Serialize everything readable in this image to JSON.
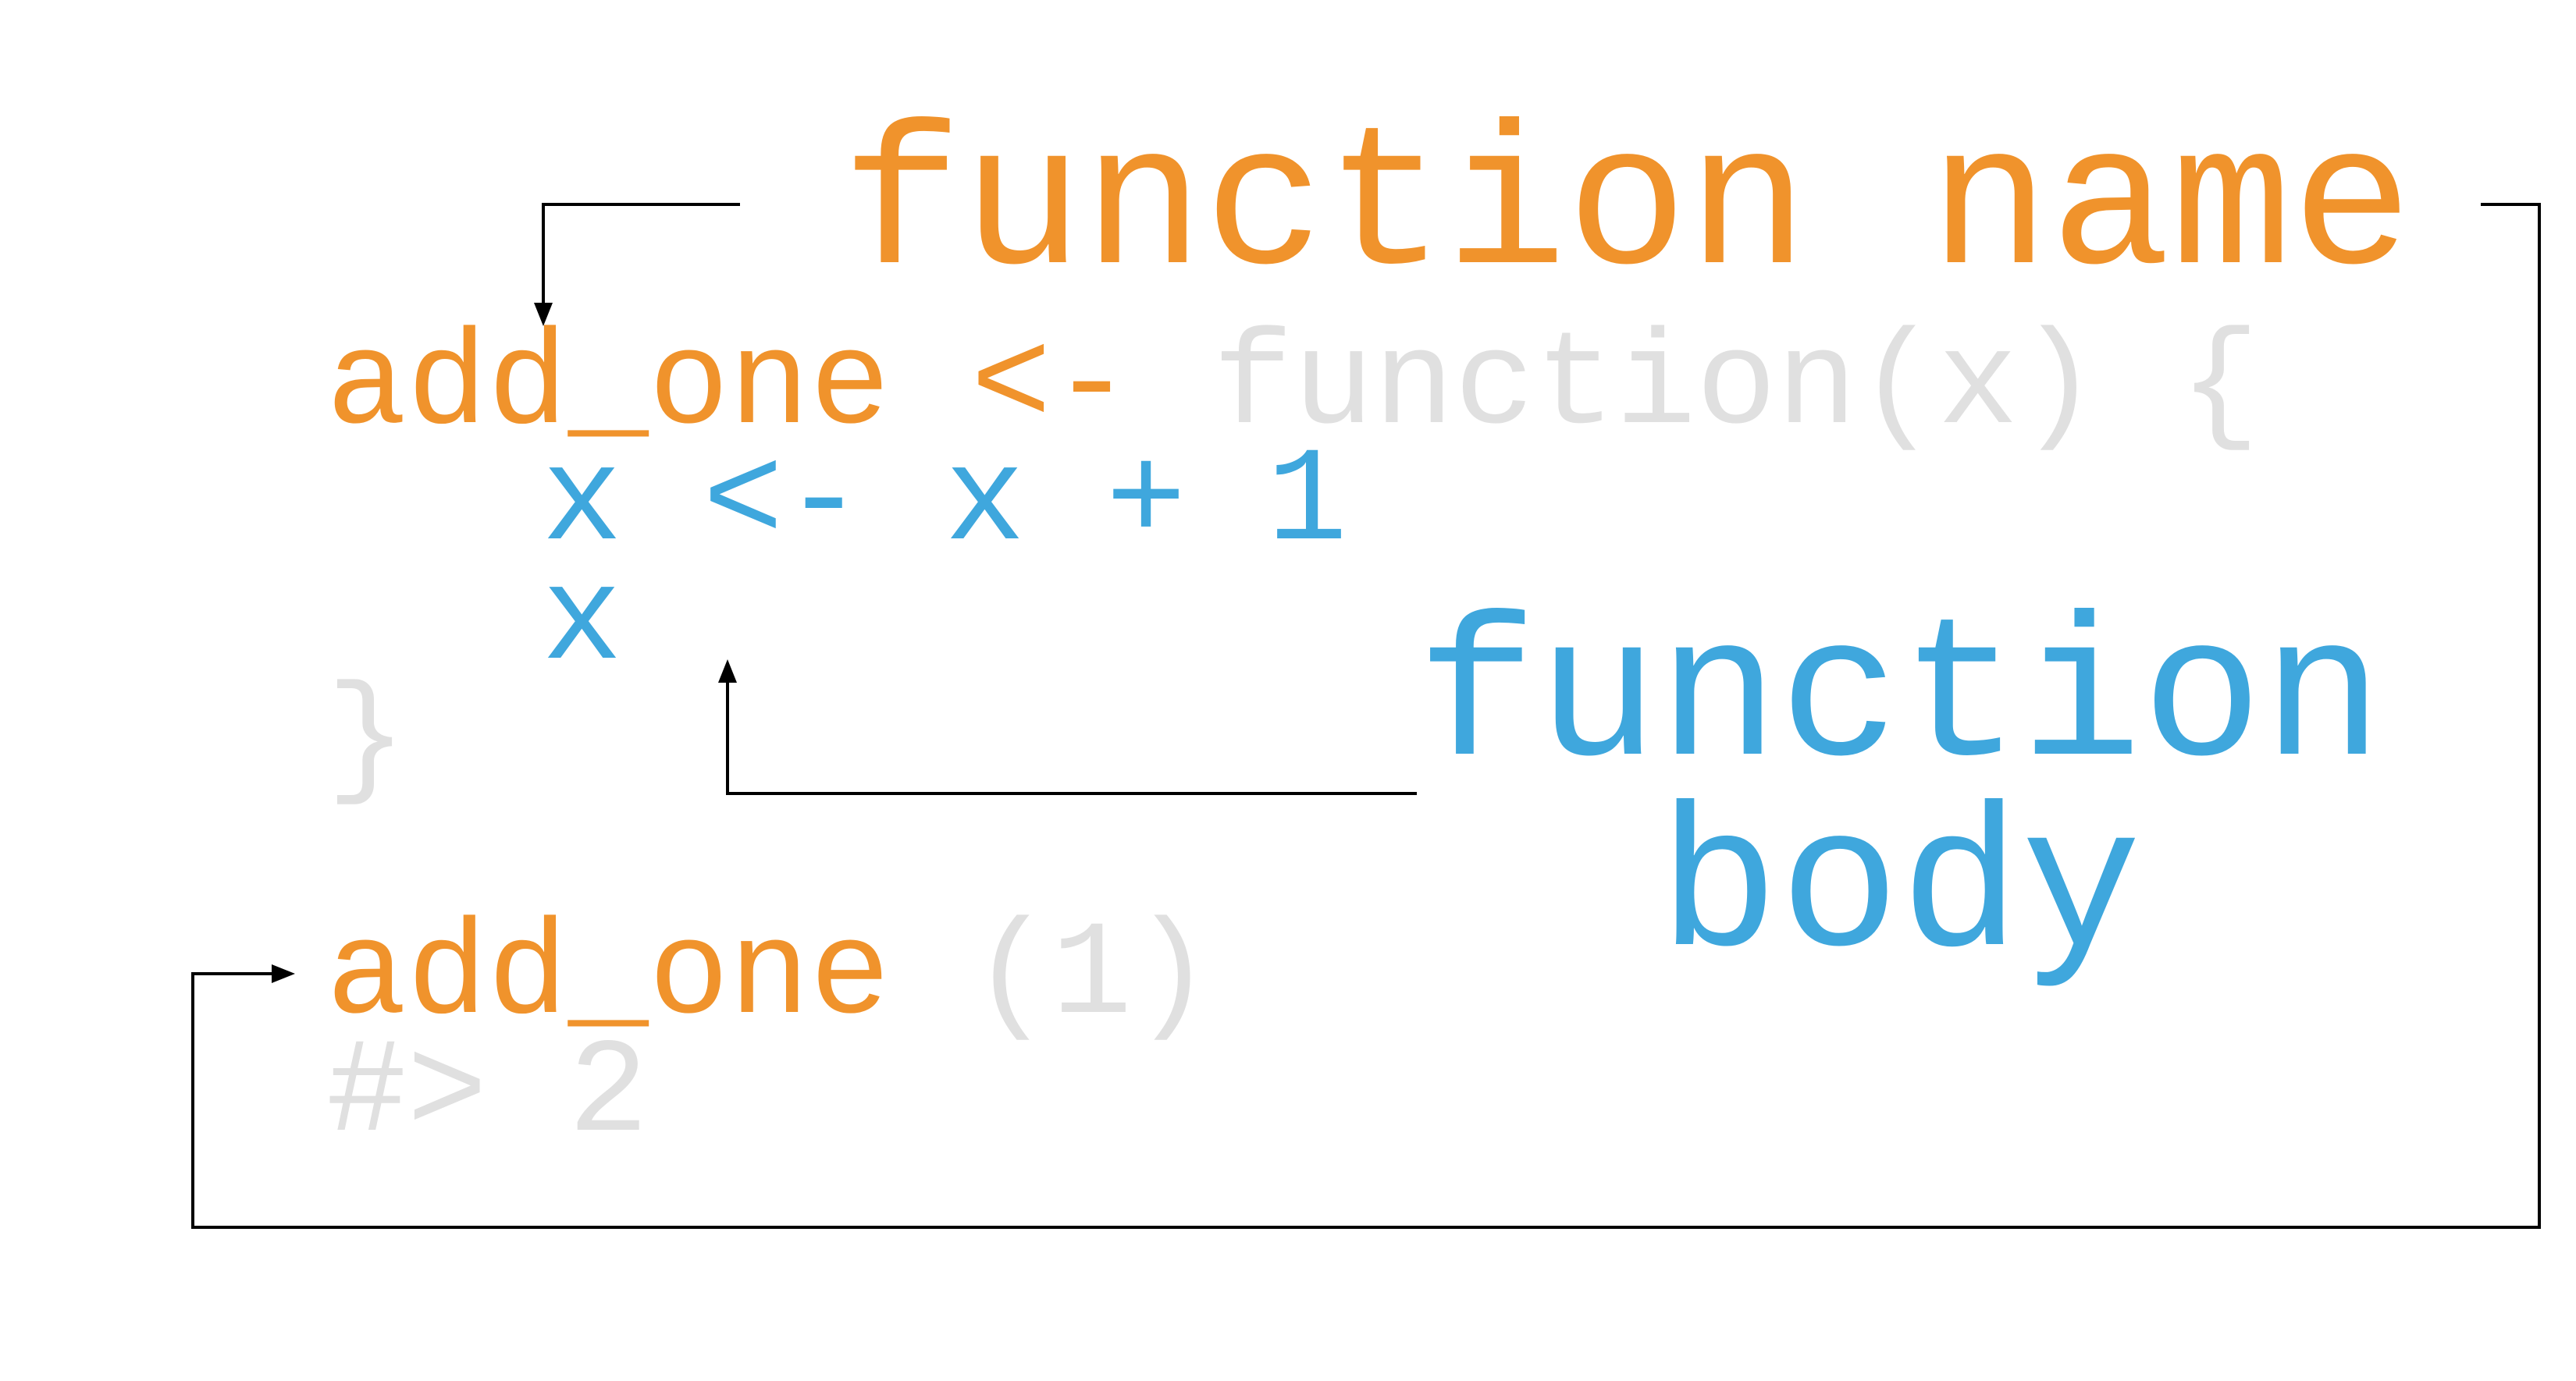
{
  "colors": {
    "orange": "#f0932c",
    "blue": "#3fa7dd",
    "gray": "#e0e0e0",
    "arrow": "#000000"
  },
  "code": {
    "line1": {
      "name": "add_one",
      "assign": "<-",
      "keyword": "function(x) {"
    },
    "line2": "x <- x + 1",
    "line3": "x",
    "line4": "}",
    "call": {
      "name": "add_one",
      "args": "(1)"
    },
    "output": "#> 2"
  },
  "labels": {
    "function_name": "function name",
    "function_body_line1": "function",
    "function_body_line2": "body"
  }
}
